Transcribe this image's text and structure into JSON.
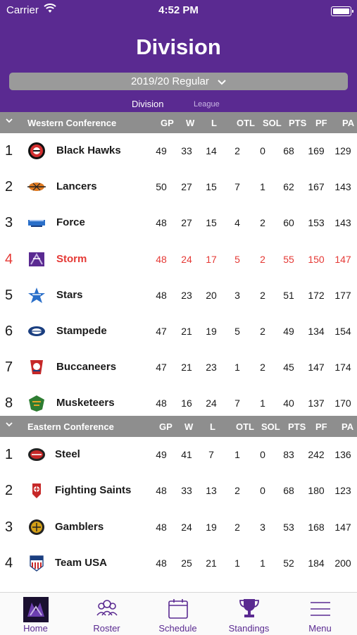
{
  "status_bar": {
    "carrier": "Carrier",
    "time": "4:52 PM"
  },
  "header": {
    "title": "Division",
    "season_selector": "2019/20 Regular",
    "tabs": {
      "active": "Division",
      "inactive": "League"
    }
  },
  "columns": [
    "GP",
    "W",
    "L",
    "OTL",
    "SOL",
    "PTS",
    "PF",
    "PA"
  ],
  "western": {
    "name": "Western Conference",
    "rows": [
      {
        "rank": "1",
        "team": "Black Hawks",
        "logo": "black-hawks-logo",
        "stats": [
          "49",
          "33",
          "14",
          "2",
          "0",
          "68",
          "169",
          "129"
        ]
      },
      {
        "rank": "2",
        "team": "Lancers",
        "logo": "lancers-logo",
        "stats": [
          "50",
          "27",
          "15",
          "7",
          "1",
          "62",
          "167",
          "143"
        ]
      },
      {
        "rank": "3",
        "team": "Force",
        "logo": "force-logo",
        "stats": [
          "48",
          "27",
          "15",
          "4",
          "2",
          "60",
          "153",
          "143"
        ]
      },
      {
        "rank": "4",
        "team": "Storm",
        "logo": "storm-logo",
        "highlight": true,
        "stats": [
          "48",
          "24",
          "17",
          "5",
          "2",
          "55",
          "150",
          "147"
        ]
      },
      {
        "rank": "5",
        "team": "Stars",
        "logo": "stars-logo",
        "stats": [
          "48",
          "23",
          "20",
          "3",
          "2",
          "51",
          "172",
          "177"
        ]
      },
      {
        "rank": "6",
        "team": "Stampede",
        "logo": "stampede-logo",
        "stats": [
          "47",
          "21",
          "19",
          "5",
          "2",
          "49",
          "134",
          "154"
        ]
      },
      {
        "rank": "7",
        "team": "Buccaneers",
        "logo": "buccaneers-logo",
        "stats": [
          "47",
          "21",
          "23",
          "1",
          "2",
          "45",
          "147",
          "174"
        ]
      },
      {
        "rank": "8",
        "team": "Musketeers",
        "logo": "musketeers-logo",
        "stats": [
          "48",
          "16",
          "24",
          "7",
          "1",
          "40",
          "137",
          "170"
        ]
      }
    ]
  },
  "eastern": {
    "name": "Eastern Conference",
    "rows": [
      {
        "rank": "1",
        "team": "Steel",
        "logo": "steel-logo",
        "stats": [
          "49",
          "41",
          "7",
          "1",
          "0",
          "83",
          "242",
          "136"
        ]
      },
      {
        "rank": "2",
        "team": "Fighting Saints",
        "logo": "fighting-saints-logo",
        "stats": [
          "48",
          "33",
          "13",
          "2",
          "0",
          "68",
          "180",
          "123"
        ]
      },
      {
        "rank": "3",
        "team": "Gamblers",
        "logo": "gamblers-logo",
        "stats": [
          "48",
          "24",
          "19",
          "2",
          "3",
          "53",
          "168",
          "147"
        ]
      },
      {
        "rank": "4",
        "team": "Team USA",
        "logo": "team-usa-logo",
        "stats": [
          "48",
          "25",
          "21",
          "1",
          "1",
          "52",
          "184",
          "200"
        ]
      }
    ]
  },
  "nav": [
    {
      "label": "Home",
      "icon": "home-logo-icon"
    },
    {
      "label": "Roster",
      "icon": "roster-icon"
    },
    {
      "label": "Schedule",
      "icon": "calendar-icon"
    },
    {
      "label": "Standings",
      "icon": "trophy-icon"
    },
    {
      "label": "Menu",
      "icon": "menu-icon"
    }
  ],
  "colors": {
    "brand": "#5a2a91",
    "highlight": "#e53935",
    "section_bg": "#8e8e8e"
  }
}
